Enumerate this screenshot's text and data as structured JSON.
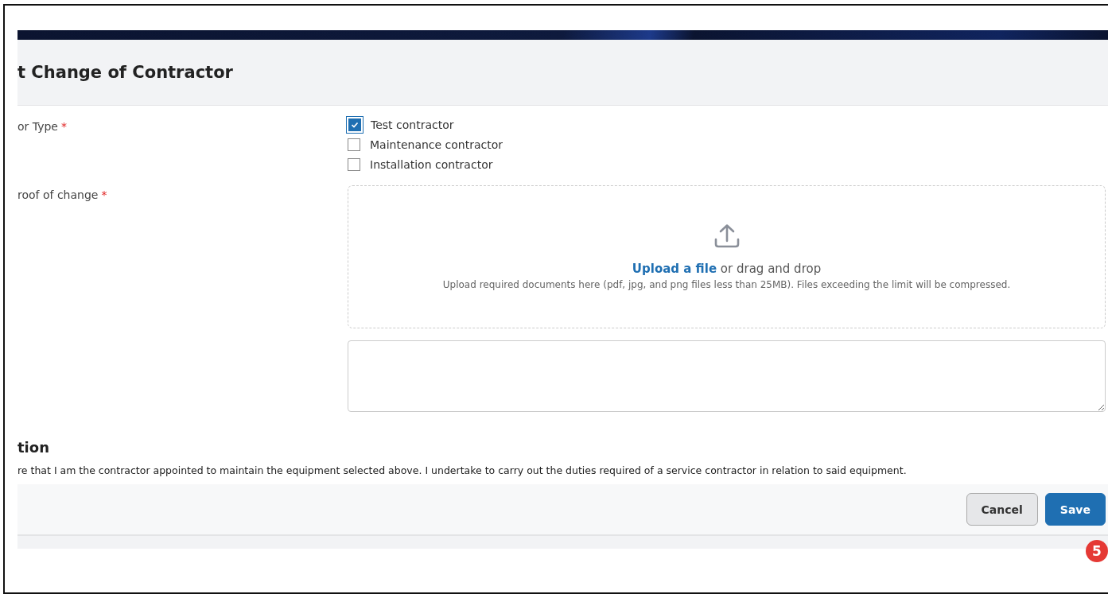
{
  "header": {
    "title": "t Change of Contractor"
  },
  "contractor_type": {
    "label": "or Type",
    "required_mark": "*",
    "options": [
      {
        "label": "Test contractor",
        "checked": true
      },
      {
        "label": "Maintenance contractor",
        "checked": false
      },
      {
        "label": "Installation contractor",
        "checked": false
      }
    ]
  },
  "proof": {
    "label": "roof of change",
    "required_mark": "*",
    "upload_link": "Upload a file",
    "upload_text": "or drag and drop",
    "hint": "Upload required documents here (pdf, jpg, and png files less than 25MB). Files exceeding the limit will be compressed."
  },
  "declaration": {
    "heading": "tion",
    "text": "re that I am the contractor appointed to maintain the equipment selected above. I undertake to carry out the duties required of a service contractor in relation to said equipment."
  },
  "footer": {
    "buttons": [
      {
        "label": "Cancel",
        "kind": "secondary"
      },
      {
        "label": "Save",
        "kind": "primary"
      }
    ],
    "badge": "5"
  }
}
